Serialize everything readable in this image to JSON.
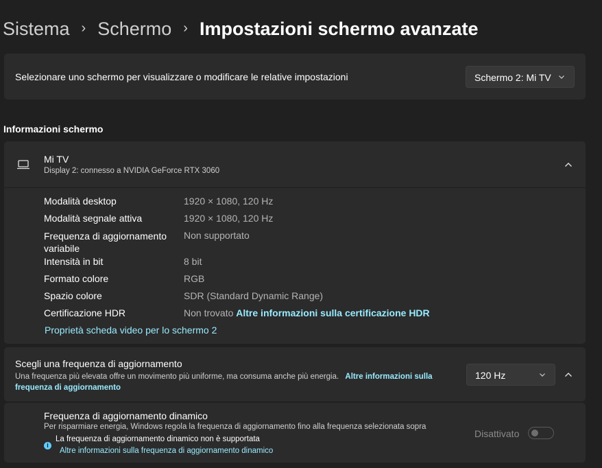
{
  "breadcrumb": {
    "items": [
      "Sistema",
      "Schermo"
    ],
    "current": "Impostazioni schermo avanzate",
    "separator": "›"
  },
  "display_select": {
    "text": "Selezionare uno schermo per visualizzare o modificare le relative impostazioni",
    "selected": "Schermo 2: Mi TV"
  },
  "info": {
    "section_title": "Informazioni schermo",
    "device_name": "Mi TV",
    "device_subtitle": "Display 2: connesso a NVIDIA GeForce RTX 3060",
    "rows": [
      {
        "label": "Modalità desktop",
        "value": "1920 × 1080, 120 Hz"
      },
      {
        "label": "Modalità segnale attiva",
        "value": "1920 × 1080, 120 Hz"
      },
      {
        "label": "Frequenza di aggiornamento variabile",
        "value": "Non supportato"
      },
      {
        "label": "Intensità in bit",
        "value": "8 bit"
      },
      {
        "label": "Formato colore",
        "value": "RGB"
      },
      {
        "label": "Spazio colore",
        "value": "SDR (Standard Dynamic Range)"
      },
      {
        "label": "Certificazione HDR",
        "value": "Non trovato",
        "link": "Altre informazioni sulla certificazione HDR"
      }
    ],
    "adapter_link": "Proprietà scheda video per lo schermo 2"
  },
  "refresh": {
    "title": "Scegli una frequenza di aggiornamento",
    "description": "Una frequenza più elevata offre un movimento più uniforme, ma consuma anche più energia.",
    "link": "Altre informazioni sulla frequenza di aggiornamento",
    "selected": "120 Hz"
  },
  "dynamic": {
    "title": "Frequenza di aggiornamento dinamico",
    "description": "Per risparmiare energia, Windows regola la frequenza di aggiornamento fino alla frequenza selezionata sopra",
    "warning": "La frequenza di aggiornamento dinamico non è supportata",
    "link": "Altre informazioni sulla frequenza di aggiornamento dinamico",
    "toggle_label": "Disattivato",
    "toggle_on": false
  },
  "colors": {
    "background": "#202020",
    "card": "#2b2b2b",
    "link": "#99ebff",
    "accent": "#60cdff"
  }
}
